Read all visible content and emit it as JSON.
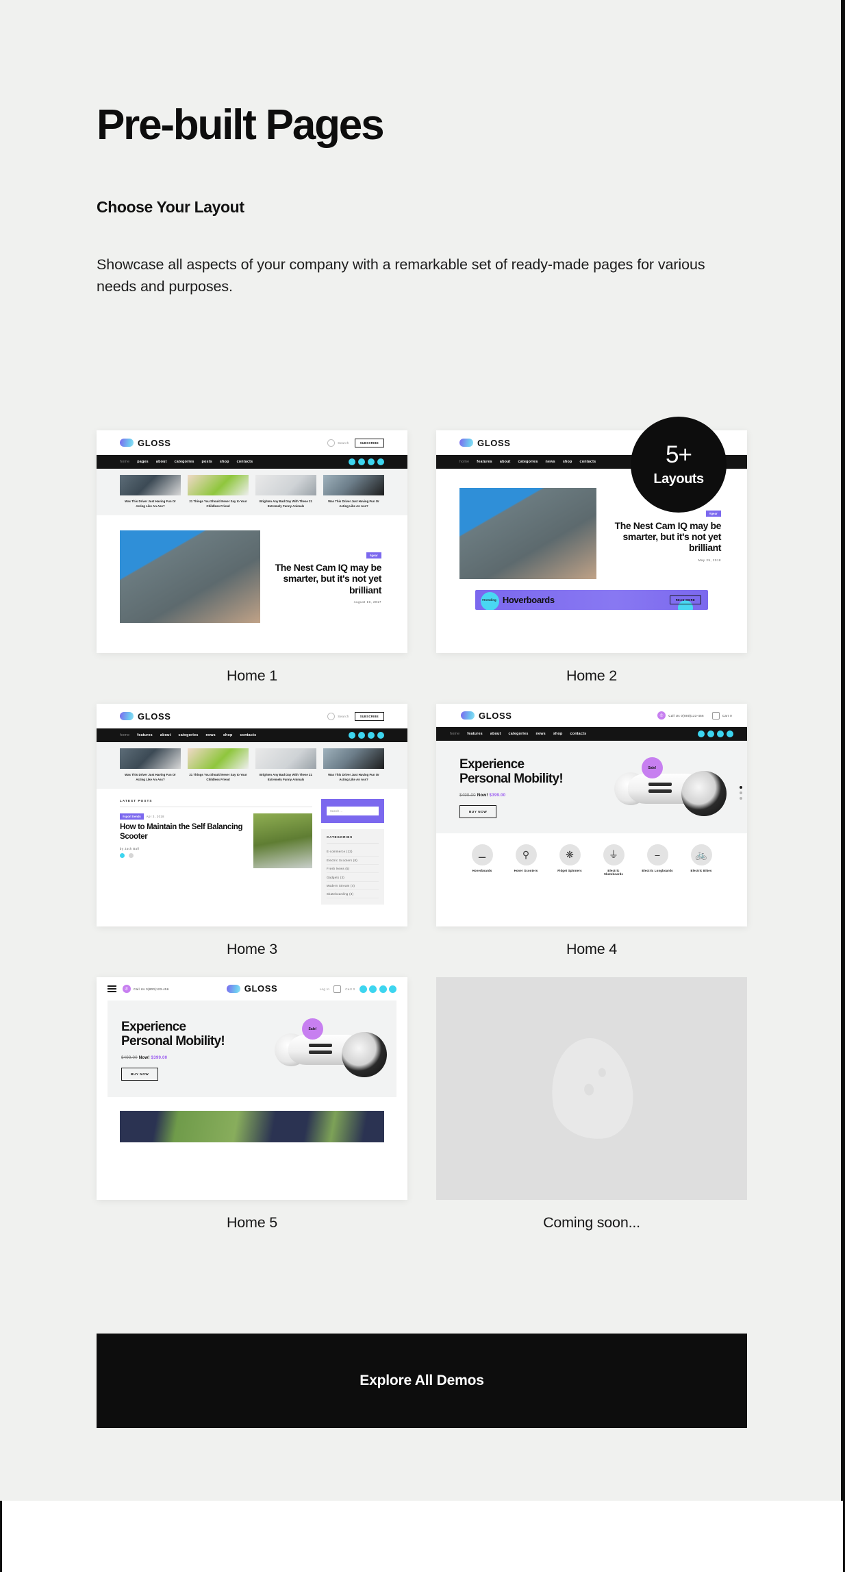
{
  "page": {
    "title": "Pre-built Pages",
    "subtitle": "Choose Your Layout",
    "lede": "Showcase all aspects of your company with a remarkable set of ready-made pages for various needs and purposes.",
    "background_color": "#f0f1ef",
    "accent_color": "#7b68ee",
    "dark_color": "#0d0d0d"
  },
  "badge": {
    "count": "5+",
    "label": "Layouts"
  },
  "cta": {
    "label": "Explore All Demos"
  },
  "brand": {
    "name": "GLOSS"
  },
  "demos": [
    {
      "id": "home-1",
      "caption": "Home 1",
      "kind": "magazine",
      "nav": [
        "home",
        "pages",
        "about",
        "categories",
        "posts",
        "shop",
        "contacts"
      ],
      "search_label": "Search",
      "subscribe_label": "SUBSCRIBE",
      "strip": [
        "Was This Driver Just Having Fun Or Acting Like An Ass?",
        "21 Things You Should Never Say to Your Childless Friend",
        "Brighten Any Bad Day With These 21 Extremely Funny Animals",
        "Was This Driver Just Having Fun Or Acting Like An Ass?"
      ],
      "hero": {
        "chip": "#gear",
        "headline": "The Nest Cam IQ may be smarter, but it's not yet brilliant",
        "meta": "August 19, 2017"
      }
    },
    {
      "id": "home-2",
      "caption": "Home 2",
      "kind": "hero-banner",
      "nav": [
        "home",
        "features",
        "about",
        "categories",
        "news",
        "shop",
        "contacts"
      ],
      "hero": {
        "chip": "#gear",
        "headline": "The Nest Cam IQ may be smarter, but it's not yet brilliant",
        "meta": "May 25, 2018"
      },
      "banner": {
        "tag": "#trending",
        "title": "Hoverboards",
        "button": "READ MORE"
      }
    },
    {
      "id": "home-3",
      "caption": "Home 3",
      "kind": "blog-sidebar",
      "nav": [
        "home",
        "features",
        "about",
        "categories",
        "news",
        "shop",
        "contacts"
      ],
      "search_label": "Search",
      "subscribe_label": "SUBSCRIBE",
      "strip": [
        "Was This Driver Just Having Fun Or Acting Like An Ass?",
        "21 Things You Should Never Say to Your Childless Friend",
        "Brighten Any Bad Day With These 21 Extremely Funny Animals",
        "Was This Driver Just Having Fun Or Acting Like An Ass?"
      ],
      "latest_posts_label": "LATEST POSTS",
      "post": {
        "tag": "#sport trends",
        "date": "Apr 3, 2018",
        "headline": "How to Maintain the Self Balancing Scooter",
        "byline": "by Jack Ball"
      },
      "sidebar": {
        "search_placeholder": "Search ...",
        "categories_title": "CATEGORIES",
        "categories": [
          "E-commerce (12)",
          "Electric Scooters (8)",
          "Fresh News (5)",
          "Gadgets (3)",
          "Modern Stream (4)",
          "Skateboarding (3)"
        ]
      }
    },
    {
      "id": "home-4",
      "caption": "Home 4",
      "kind": "shop",
      "nav": [
        "home",
        "features",
        "about",
        "categories",
        "news",
        "shop",
        "contacts"
      ],
      "call_us": "Call Us 0(800)123-456",
      "cart_label": "Cart 0",
      "hero": {
        "headline": "Experience Personal Mobility!",
        "old_price": "$499.00",
        "now_label": "Now!",
        "price": "$399.00",
        "button": "BUY NOW",
        "badge": "Sale!"
      },
      "categories": [
        "Hoverboards",
        "Hover Scooters",
        "Fidget Spinners",
        "Electric Skateboards",
        "Electric Longboards",
        "Electric Bikes"
      ]
    },
    {
      "id": "home-5",
      "caption": "Home 5",
      "kind": "shop-centered",
      "call_us": "Call Us 0(800)123-456",
      "login_label": "Log In",
      "cart_label": "Cart 0",
      "hero": {
        "headline": "Experience Personal Mobility!",
        "old_price": "$499.00",
        "now_label": "Now!",
        "price": "$399.00",
        "button": "BUY NOW",
        "badge": "Sale!"
      }
    },
    {
      "id": "coming-soon",
      "caption": "Coming soon...",
      "kind": "placeholder"
    }
  ]
}
